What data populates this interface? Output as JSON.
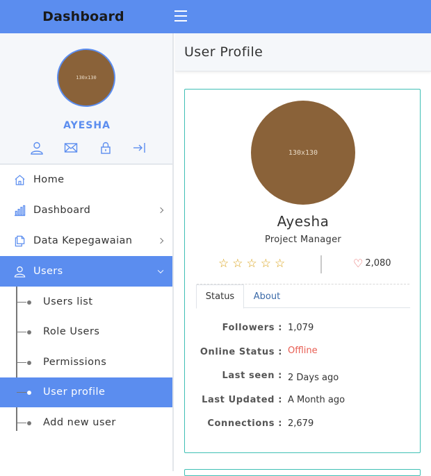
{
  "app": {
    "brand": "Dashboard"
  },
  "sidebar": {
    "avatar_text": "130x130",
    "user_name": "AYESHA",
    "icons": [
      "user-icon",
      "mail-icon",
      "lock-icon",
      "logout-icon"
    ],
    "menu": [
      {
        "label": "Home",
        "icon": "home-icon"
      },
      {
        "label": "Dashboard",
        "icon": "bar-chart-icon"
      },
      {
        "label": "Data Kepegawaian",
        "icon": "documents-icon"
      },
      {
        "label": "Users",
        "icon": "user-icon"
      }
    ],
    "submenu": [
      {
        "label": "Users list"
      },
      {
        "label": "Role Users"
      },
      {
        "label": "Permissions"
      },
      {
        "label": "User profile"
      },
      {
        "label": "Add new user"
      }
    ]
  },
  "page": {
    "title": "User Profile"
  },
  "profile": {
    "avatar_text": "130x130",
    "name": "Ayesha",
    "role": "Project Manager",
    "stars": [
      "☆",
      "☆",
      "☆",
      "☆",
      "☆"
    ],
    "likes": "2,080",
    "tabs": {
      "status": "Status",
      "about": "About"
    },
    "fields": {
      "followers": {
        "label": "Followers :",
        "value": "1,079"
      },
      "online": {
        "label": "Online Status :",
        "value": "Offline"
      },
      "last_seen": {
        "label": "Last seen :",
        "value": "2 Days ago"
      },
      "last_updated": {
        "label": "Last Updated :",
        "value": "A Month ago"
      },
      "connections": {
        "label": "Connections :",
        "value": "2,679"
      }
    }
  },
  "colors": {
    "accent": "#5b8def",
    "card_border": "#3ebfb4",
    "star": "#d9a013",
    "offline": "#e85d52",
    "avatar": "#8a6239"
  }
}
